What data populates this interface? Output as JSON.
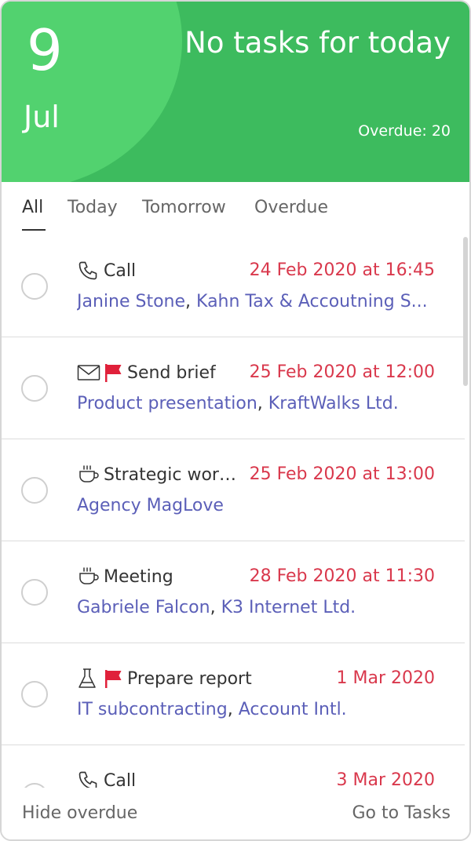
{
  "header": {
    "day": "9",
    "month": "Jul",
    "title": "No tasks for today",
    "overdue_label": "Overdue: 20",
    "accent_color": "#3dbb5e"
  },
  "tabs": [
    {
      "label": "All",
      "active": true
    },
    {
      "label": "Today",
      "active": false
    },
    {
      "label": "Tomorrow",
      "active": false
    },
    {
      "label": "Overdue",
      "active": false
    }
  ],
  "tasks": [
    {
      "type_icon": "phone-icon",
      "flagged": false,
      "name": "Call",
      "due": "24 Feb 2020 at 16:45",
      "link1": "Janine Stone",
      "sep": ", ",
      "link2": "Kahn Tax & Accoutning S..."
    },
    {
      "type_icon": "envelope-icon",
      "flagged": true,
      "name": "Send brief",
      "due": "25 Feb 2020 at 12:00",
      "link1": "Product presentation",
      "sep": ", ",
      "link2": "KraftWalks Ltd."
    },
    {
      "type_icon": "coffee-cup-icon",
      "flagged": false,
      "name": "Strategic wor…",
      "due": "25 Feb 2020 at 13:00",
      "link1": "Agency MagLove",
      "sep": "",
      "link2": ""
    },
    {
      "type_icon": "coffee-cup-icon",
      "flagged": false,
      "name": "Meeting",
      "due": "28 Feb 2020 at 11:30",
      "link1": "Gabriele Falcon",
      "sep": ", ",
      "link2": "K3 Internet Ltd."
    },
    {
      "type_icon": "flask-icon",
      "flagged": true,
      "name": "Prepare report",
      "due": "1 Mar 2020",
      "link1": "IT subcontracting",
      "sep": ", ",
      "link2": "Account Intl."
    },
    {
      "type_icon": "phone-icon",
      "flagged": false,
      "name": "Call",
      "due": "3 Mar 2020",
      "link1": "",
      "sep": "",
      "link2": ""
    }
  ],
  "footer": {
    "hide_overdue": "Hide overdue",
    "go_to_tasks": "Go to Tasks"
  },
  "colors": {
    "due_date": "#d9384c",
    "link": "#5b5fb8",
    "flag": "#e0203a"
  }
}
